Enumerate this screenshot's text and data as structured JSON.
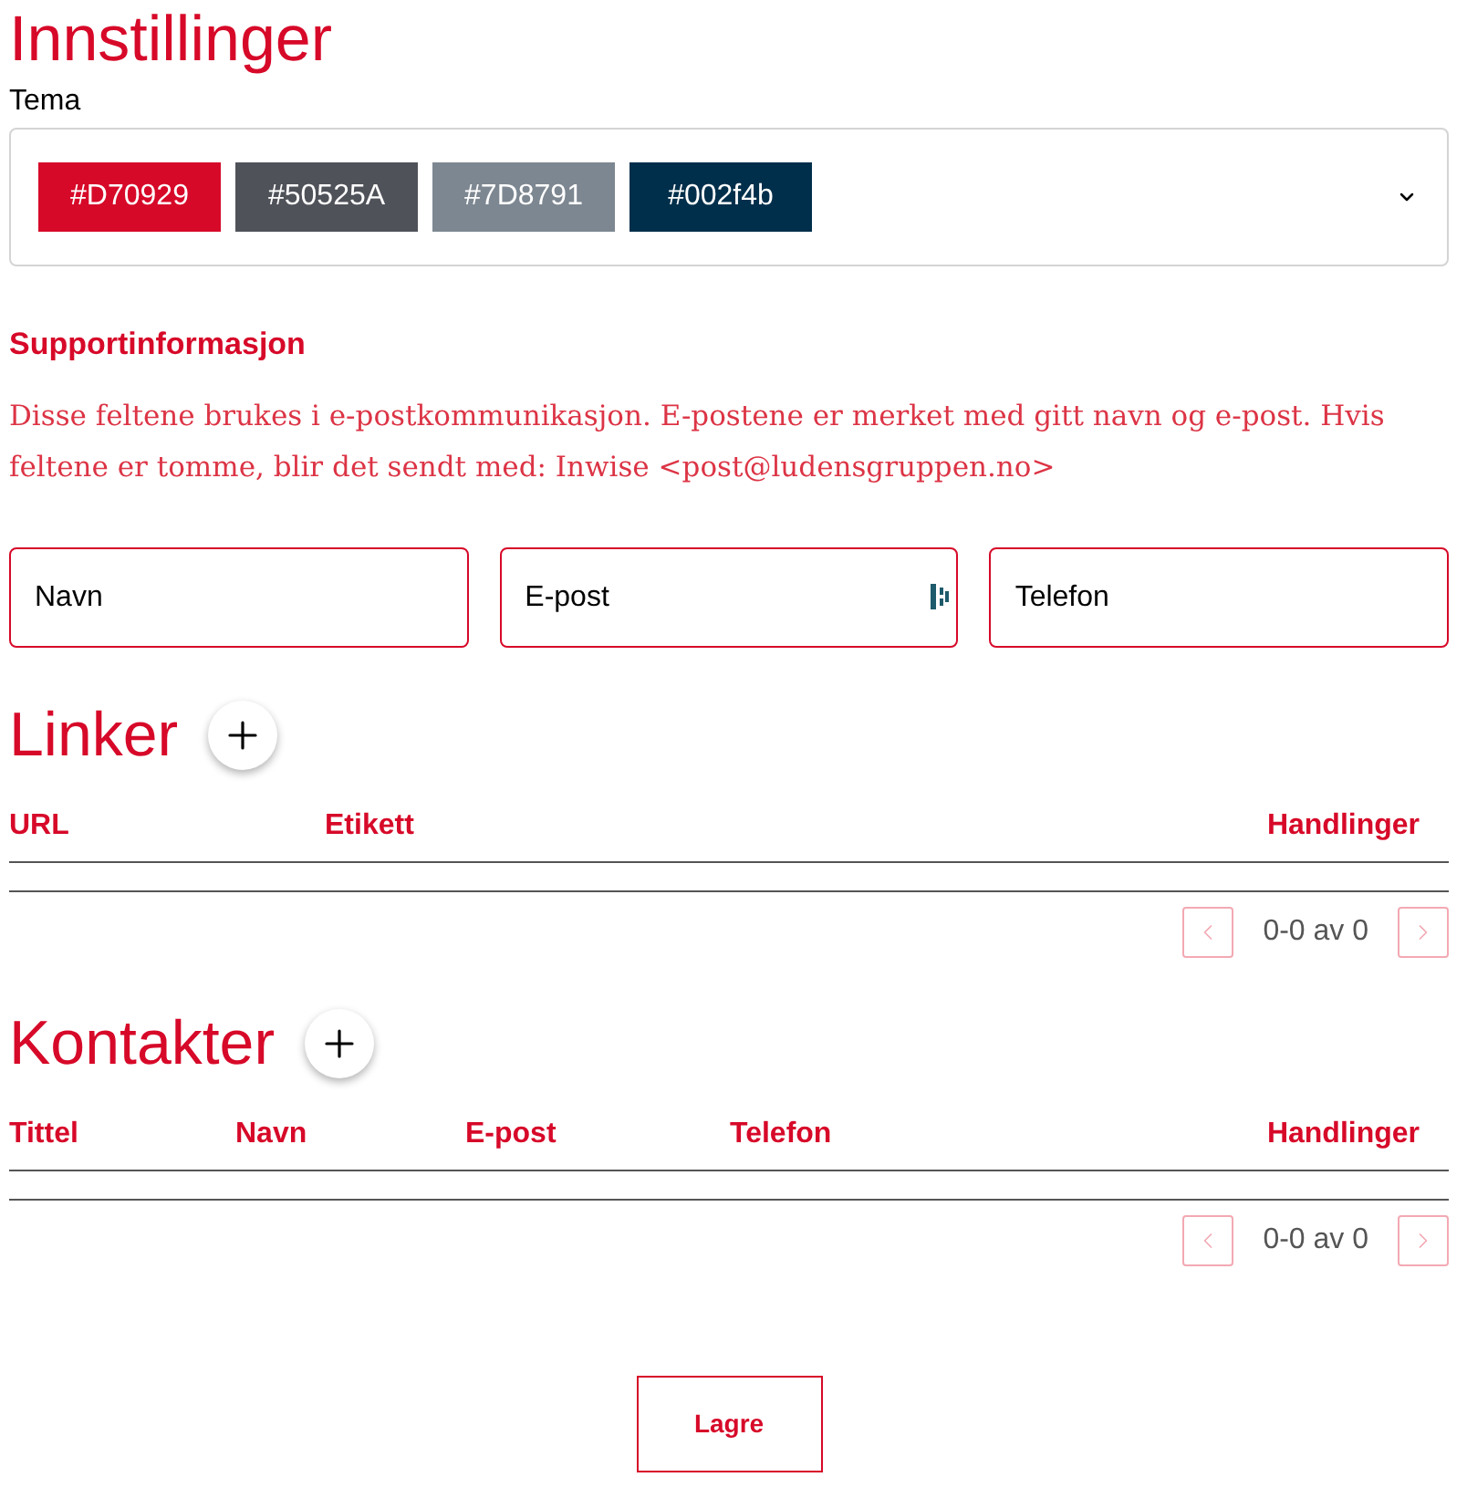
{
  "page": {
    "title": "Innstillinger"
  },
  "theme": {
    "label": "Tema",
    "swatches": [
      {
        "label": "#D70929",
        "color": "#d70929"
      },
      {
        "label": "#50525A",
        "color": "#50525a"
      },
      {
        "label": "#7D8791",
        "color": "#7d8791"
      },
      {
        "label": "#002f4b",
        "color": "#002f4b"
      }
    ]
  },
  "support": {
    "heading": "Supportinformasjon",
    "description": "Disse feltene brukes i e-postkommunikasjon. E-postene er merket med gitt navn og e-post. Hvis feltene er tomme, blir det sendt med: Inwise <post@ludensgruppen.no>",
    "fields": [
      {
        "kind": "text",
        "placeholder": "Navn"
      },
      {
        "kind": "email",
        "placeholder": "E-post"
      },
      {
        "kind": "text",
        "placeholder": "Telefon"
      }
    ]
  },
  "links": {
    "heading": "Linker",
    "columns": [
      "URL",
      "Etikett",
      "Handlinger"
    ],
    "pagination": {
      "range": "0-0 av 0",
      "previous": {
        "disabled": true
      },
      "next": {
        "disabled": true
      }
    }
  },
  "contacts": {
    "heading": "Kontakter",
    "columns": [
      "Tittel",
      "Navn",
      "E-post",
      "Telefon",
      "Handlinger"
    ],
    "pagination": {
      "range": "0-0 av 0",
      "previous": {
        "disabled": true
      },
      "next": {
        "disabled": true
      }
    }
  },
  "save_button": {
    "label": "Lagre"
  }
}
